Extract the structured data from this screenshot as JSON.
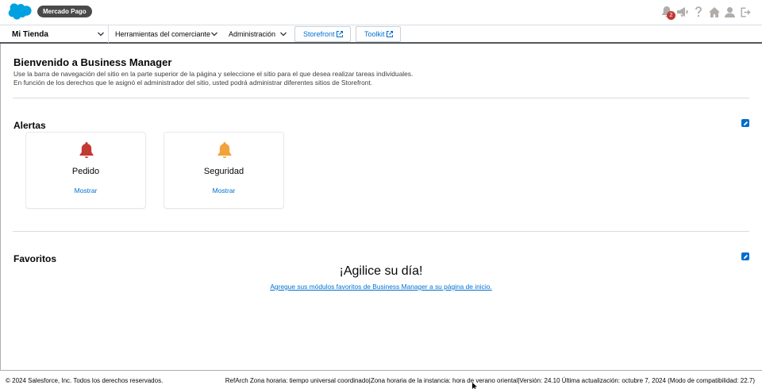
{
  "header": {
    "site_pill": "Mercado Pago",
    "notifications_badge": "2"
  },
  "nav": {
    "site_selector": "Mi Tienda",
    "menus": [
      "Herramientas del comerciante",
      "Administración"
    ],
    "storefront_button": "Storefront",
    "toolkit_button": "Toolkit"
  },
  "welcome": {
    "title": "Bienvenido a Business Manager",
    "line1": "Use la barra de navegación del sitio en la parte superior de la página y seleccione el sitio para el que desea realizar tareas individuales.",
    "line2": "En función de los derechos que le asignó el administrador del sitio, usted podrá administrar diferentes sitios de Storefront."
  },
  "alerts": {
    "title": "Alertas",
    "cards": [
      {
        "name": "Pedido",
        "action": "Mostrar",
        "bell_color": "#c23934"
      },
      {
        "name": "Seguridad",
        "action": "Mostrar",
        "bell_color": "#f0a33c"
      }
    ]
  },
  "favorites": {
    "title": "Favoritos",
    "heading": "¡Agilice su día!",
    "link": "Agregue sus módulos favoritos de Business Manager a su página de inicio."
  },
  "footer": {
    "copyright": "© 2024 Salesforce, Inc. Todos los derechos reservados.",
    "info": "RefArch Zona horaria: tiempo universal coordinado|Zona horaria de la instancia: hora de verano oriental|Versión: 24.10 Última actualización: octubre 7, 2024 (Modo de compatibilidad: 22.7)"
  },
  "colors": {
    "brand_blue": "#00a1e0",
    "link_blue": "#0070d2",
    "danger_red": "#c23934",
    "warning_orange": "#f0a33c"
  }
}
